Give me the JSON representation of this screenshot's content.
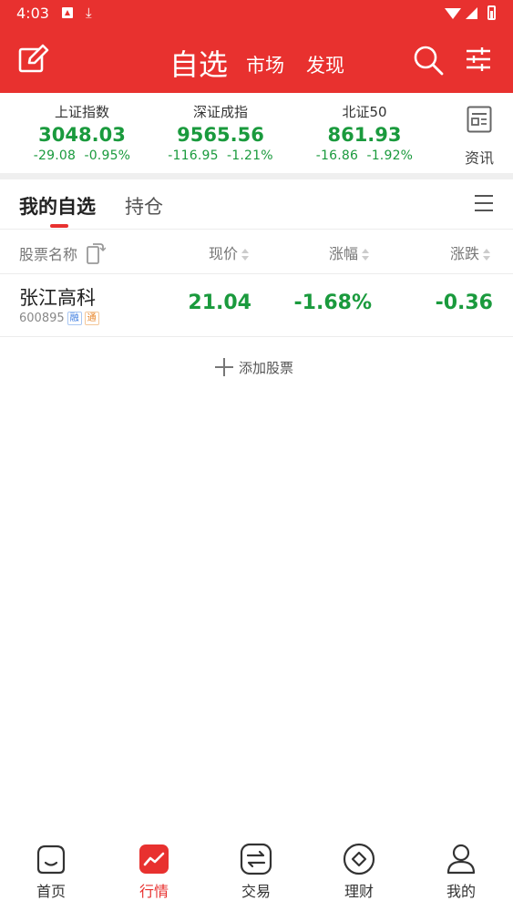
{
  "status_bar": {
    "time": "4:03"
  },
  "header": {
    "title": "自选",
    "tabs": [
      "市场",
      "发现"
    ],
    "accent": "#e8312f"
  },
  "indices": [
    {
      "name": "上证指数",
      "price": "3048.03",
      "change": "-29.08",
      "pct": "-0.95%"
    },
    {
      "name": "深证成指",
      "price": "9565.56",
      "change": "-116.95",
      "pct": "-1.21%"
    },
    {
      "name": "北证50",
      "price": "861.93",
      "change": "-16.86",
      "pct": "-1.92%"
    }
  ],
  "news": {
    "label": "资讯"
  },
  "tabs": {
    "watchlist": "我的自选",
    "holdings": "持仓"
  },
  "table": {
    "headers": {
      "name": "股票名称",
      "price": "现价",
      "pct": "涨幅",
      "change": "涨跌"
    },
    "rows": [
      {
        "name": "张江高科",
        "code": "600895",
        "tag1": "融",
        "tag2": "通",
        "price": "21.04",
        "pct": "-1.68%",
        "change": "-0.36"
      }
    ]
  },
  "add_stock": "添加股票",
  "bottom_nav": [
    {
      "label": "首页",
      "icon": "home-icon"
    },
    {
      "label": "行情",
      "icon": "market-chart-icon",
      "active": true
    },
    {
      "label": "交易",
      "icon": "trade-exchange-icon"
    },
    {
      "label": "理财",
      "icon": "wealth-diamond-icon"
    },
    {
      "label": "我的",
      "icon": "profile-icon"
    }
  ],
  "colors": {
    "down_green": "#1a9a3d",
    "accent_red": "#e8312f"
  }
}
